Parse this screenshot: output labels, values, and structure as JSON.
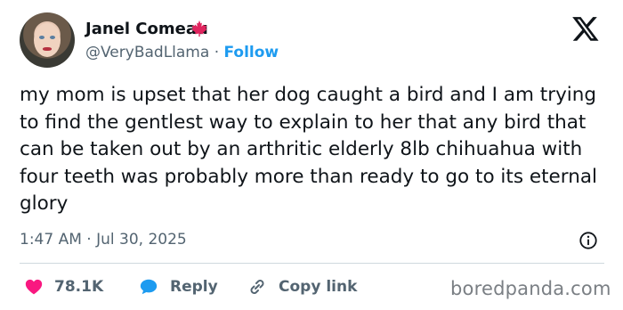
{
  "author": {
    "name": "Janel Comeau",
    "handle": "@VeryBadLlama",
    "separator": "·",
    "follow_label": "Follow",
    "flag_icon": "maple-leaf-icon"
  },
  "tweet": {
    "text": "my mom is upset that her dog caught a bird and I am trying to find the gentlest way to explain to her that any bird that can be taken out by an arthritic elderly 8lb chihuahua with four teeth was probably more than ready to go to its eternal glory",
    "timestamp": "1:47 AM · Jul 30, 2025"
  },
  "actions": {
    "likes_count": "78.1K",
    "reply_label": "Reply",
    "copy_link_label": "Copy link"
  },
  "colors": {
    "accent": "#1d9bf0",
    "like": "#f91880",
    "maple": "#e0245e",
    "muted": "#536471"
  },
  "watermark": "boredpanda.com"
}
